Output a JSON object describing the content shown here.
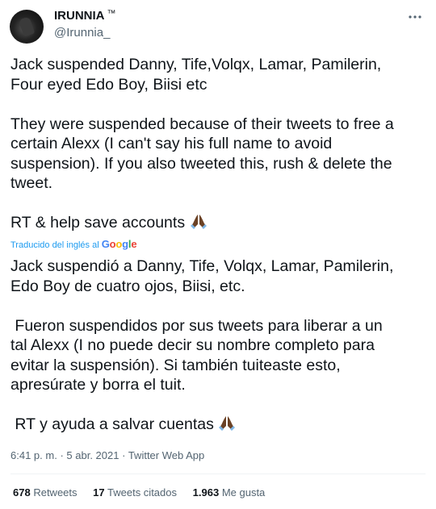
{
  "author": {
    "display_name": "IRUNNIA",
    "tm": "™",
    "handle": "@Irunnia_",
    "more_icon": "more-dots-icon"
  },
  "tweet": {
    "original": [
      "Jack suspended Danny, Tife,Volqx, Lamar, Pamilerin,",
      "Four eyed Edo Boy, Biisi etc",
      "",
      "They were suspended because of their tweets to free a",
      "certain Alexx (I can't say his full name to avoid",
      "suspension). If you also tweeted this, rush & delete the",
      "tweet.",
      "",
      "RT & help save accounts"
    ],
    "translated_by": "Traducido del inglés al",
    "google_word": "Google",
    "translation": [
      "Jack suspendió a Danny, Tife, Volqx, Lamar, Pamilerin,",
      "Edo Boy de cuatro ojos, Biisi, etc.",
      "",
      " Fueron suspendidos por sus tweets para liberar a un",
      "tal Alexx (I no puede decir su nombre completo para",
      "evitar la suspensión). Si también tuiteaste esto,",
      "apresúrate y borra el tuit.",
      "",
      " RT y ayuda a salvar cuentas"
    ],
    "emoji_icon": "praying-hands-emoji"
  },
  "meta": {
    "time": "6:41 p. m.",
    "sep": "·",
    "date": "5 abr. 2021",
    "source": "Twitter Web App"
  },
  "stats": {
    "retweets_count": "678",
    "retweets_label": "Retweets",
    "quotes_count": "17",
    "quotes_label": "Tweets citados",
    "likes_count": "1.963",
    "likes_label": "Me gusta"
  },
  "colors": {
    "text": "#0f1419",
    "secondary": "#536471",
    "link": "#1d9bf0",
    "emoji_skin": "#6b4226"
  }
}
